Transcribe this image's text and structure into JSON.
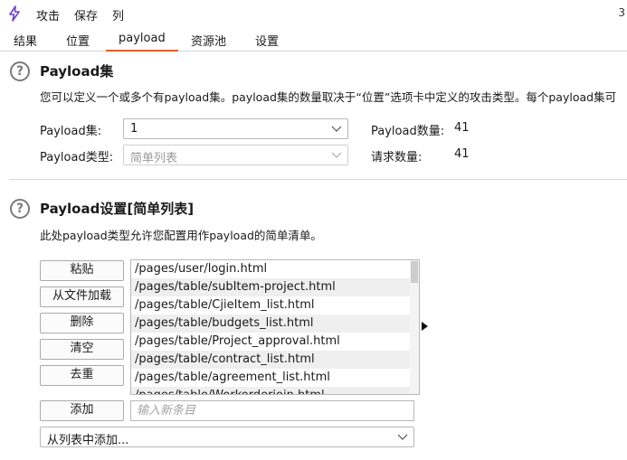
{
  "menubar": {
    "items": [
      "攻击",
      "保存",
      "列"
    ],
    "corner_text": "3"
  },
  "tabs": [
    "结果",
    "位置",
    "payload",
    "资源池",
    "设置"
  ],
  "active_tab": "payload",
  "payload_sets": {
    "title": "Payload集",
    "description": "您可以定义一个或多个有payload集。payload集的数量取决于“位置”选项卡中定义的攻击类型。每个payload集可",
    "set_label": "Payload集:",
    "set_value": "1",
    "type_label": "Payload类型:",
    "type_value": "简单列表",
    "count_label": "Payload数量:",
    "count_value": "41",
    "request_label": "请求数量:",
    "request_value": "41"
  },
  "payload_settings": {
    "title": "Payload设置[简单列表]",
    "description": "此处payload类型允许您配置用作payload的简单清单。",
    "buttons": {
      "paste": "粘贴",
      "load": "从文件加载",
      "remove": "删除",
      "clear": "清空",
      "dedupe": "去重",
      "add": "添加"
    },
    "list_items": [
      "/pages/user/login.html",
      "/pages/table/subItem-project.html",
      "/pages/table/CjieItem_list.html",
      "/pages/table/budgets_list.html",
      "/pages/table/Project_approval.html",
      "/pages/table/contract_list.html",
      "/pages/table/agreement_list.html",
      "/pages/table/Workorderjoin.html"
    ],
    "new_item_placeholder": "输入新条目",
    "add_from_list": "从列表中添加..."
  },
  "colors": {
    "accent": "#e8602c",
    "app_icon": "#6b3fd4"
  }
}
